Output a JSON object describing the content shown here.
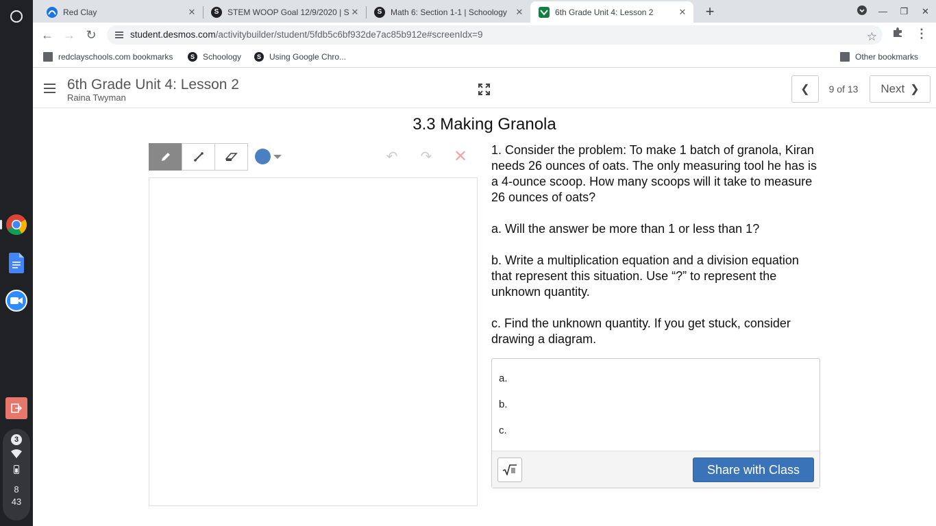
{
  "shelf": {
    "clock": {
      "hour": "8",
      "minute": "43"
    },
    "notification_count": "3"
  },
  "tabs": [
    {
      "title": "Red Clay",
      "favicon": "redclay-icon"
    },
    {
      "title": "STEM WOOP Goal 12/9/2020 | S",
      "favicon": "schoology-icon"
    },
    {
      "title": "Math 6: Section 1-1 | Schoology",
      "favicon": "schoology-icon"
    },
    {
      "title": "6th Grade Unit 4: Lesson 2",
      "favicon": "desmos-icon"
    }
  ],
  "omnibox": {
    "domain": "student.desmos.com",
    "path": "/activitybuilder/student/5fdb5c6bf932de7ac85b912e#screenIdx=9"
  },
  "bookmarks": {
    "items": [
      "redclayschools.com bookmarks",
      "Schoology",
      "Using Google Chro..."
    ],
    "other": "Other bookmarks"
  },
  "header": {
    "title": "6th Grade Unit 4: Lesson 2",
    "student": "Raina Twyman",
    "screen_count": "9 of 13",
    "next_label": "Next"
  },
  "screen": {
    "title": "3.3 Making Granola",
    "prompt": [
      "1. Consider the problem: To make 1 batch of granola, Kiran needs 26 ounces of oats. The only measuring tool he has is a 4-ounce scoop. How many scoops will it take to measure 26 ounces of oats?",
      "a. Will the answer be more than 1 or less than 1?",
      "b. Write a multiplication equation and a division equation that represent this situation. Use “?” to represent the unknown quantity.",
      "c. Find the unknown quantity. If you get stuck, consider drawing a diagram."
    ],
    "response_lines": [
      "a.",
      "b.",
      "c."
    ],
    "share_label": "Share with Class"
  },
  "colors": {
    "sketch_color": "#4a7fc1",
    "share_button": "#3b73b9"
  }
}
